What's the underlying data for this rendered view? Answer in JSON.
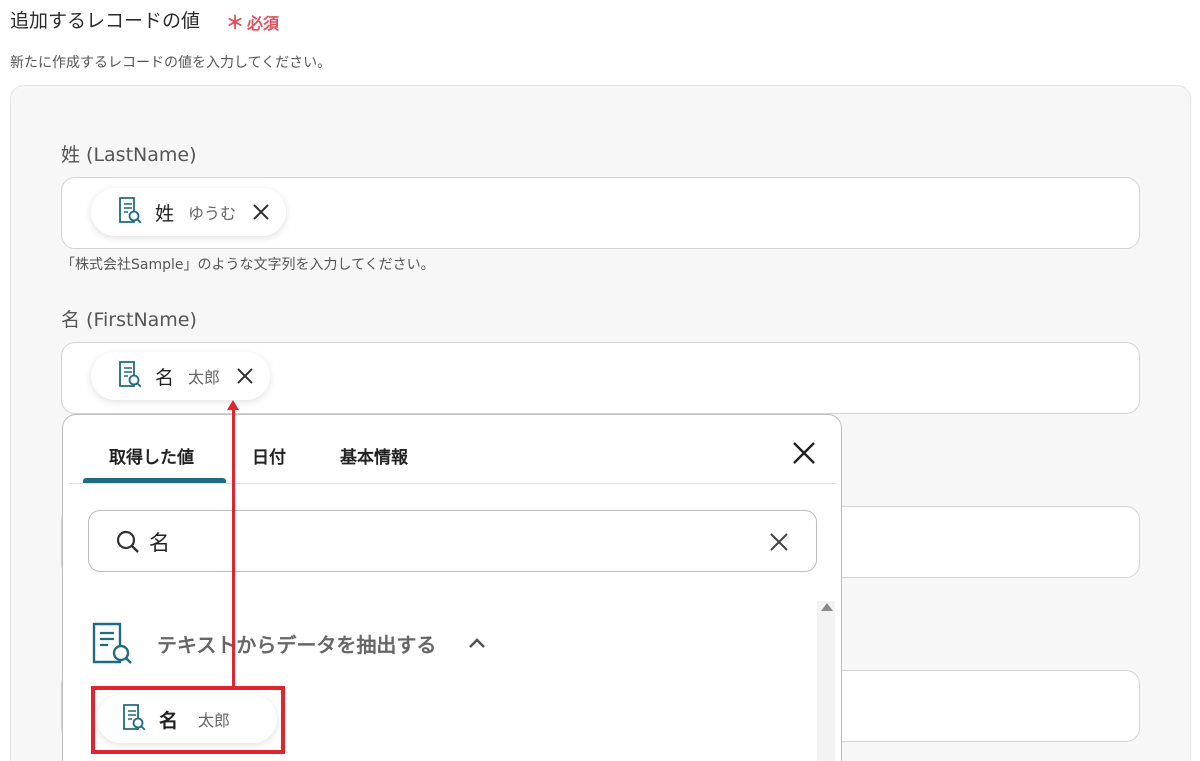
{
  "section": {
    "title": "追加するレコードの値",
    "required_mark": "＊",
    "required_label": "必須",
    "description": "新たに作成するレコードの値を入力してください。"
  },
  "fields": {
    "last_name": {
      "label": "姓 (LastName)",
      "chip_icon": "document-search-icon",
      "chip_name": "姓",
      "chip_value": "ゆうむ",
      "hint": "「株式会社Sample」のような文字列を入力してください。"
    },
    "first_name": {
      "label": "名 (FirstName)",
      "chip_icon": "document-search-icon",
      "chip_name": "名",
      "chip_value": "太郎"
    }
  },
  "popup": {
    "tabs": [
      "取得した値",
      "日付",
      "基本情報"
    ],
    "active_tab": 0,
    "search_value": "名",
    "group_title": "テキストからデータを抽出する",
    "result_chip": {
      "name": "名",
      "value": "太郎"
    }
  },
  "colors": {
    "accent": "#1f6b80",
    "required": "#e2505f",
    "annotation": "#e0252e"
  }
}
